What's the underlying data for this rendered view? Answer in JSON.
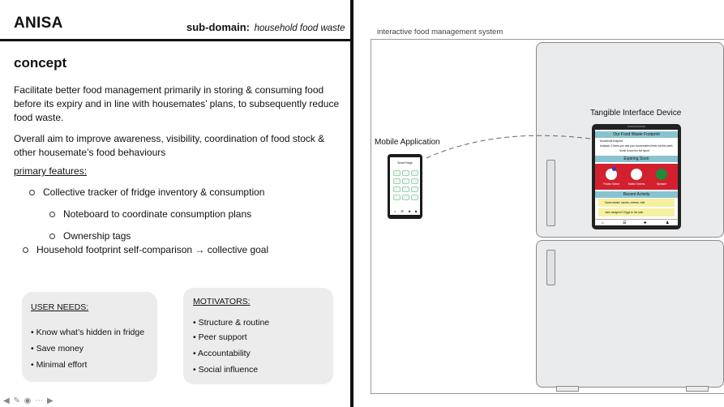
{
  "left": {
    "brand": "ANISA",
    "subdomain_label": "sub-domain:",
    "subdomain_value": "household food waste",
    "concept_title": "concept",
    "paragraph1": "Facilitate better food management primarily in storing & consuming food before its expiry and in line with housemates’ plans, to subsequently reduce food waste.",
    "paragraph2": "Overall aim to improve awareness, visibility, coordination of food stock & other housemate’s food behaviours",
    "features_title": "primary features:",
    "features": [
      "Collective tracker of fridge inventory & consumption",
      "Noteboard to coordinate consumption plans",
      "Ownership tags",
      "Household footprint self-comparison → collective goal"
    ],
    "user_needs": {
      "title": "USER NEEDS:",
      "items": [
        "• Know what’s hidden in fridge",
        "• Save money",
        "• Minimal effort"
      ]
    },
    "motivators": {
      "title": "MOTIVATORS:",
      "items": [
        "• Structure & routine",
        "• Peer support",
        "• Accountability",
        "• Social influence"
      ]
    }
  },
  "right": {
    "caption": "interactive food management system",
    "tangible_label": "Tangible Interface Device",
    "mobile_label": "Mobile Application",
    "device_screen": {
      "band1": "Our Food Waste Footprint",
      "line1": "Household footprint:",
      "line2": "Analysis: 2 items you and your housemates threw out this week",
      "line3": "Scroll to see the full report",
      "band2": "Expiring Soon",
      "items": [
        "Potato Salad",
        "Salad Greens",
        "Spinach"
      ],
      "band3": "Recent Activity",
      "activity": [
        "Sarah added: carrots, cheese, milk",
        "Jane assigned 2 Eggs to her plan"
      ]
    },
    "phone_title": "Smart Fridge"
  },
  "colors": {
    "accent_red": "#d3202e",
    "teal_band": "#88c3cf",
    "yellow_note": "#f6f0a2"
  }
}
